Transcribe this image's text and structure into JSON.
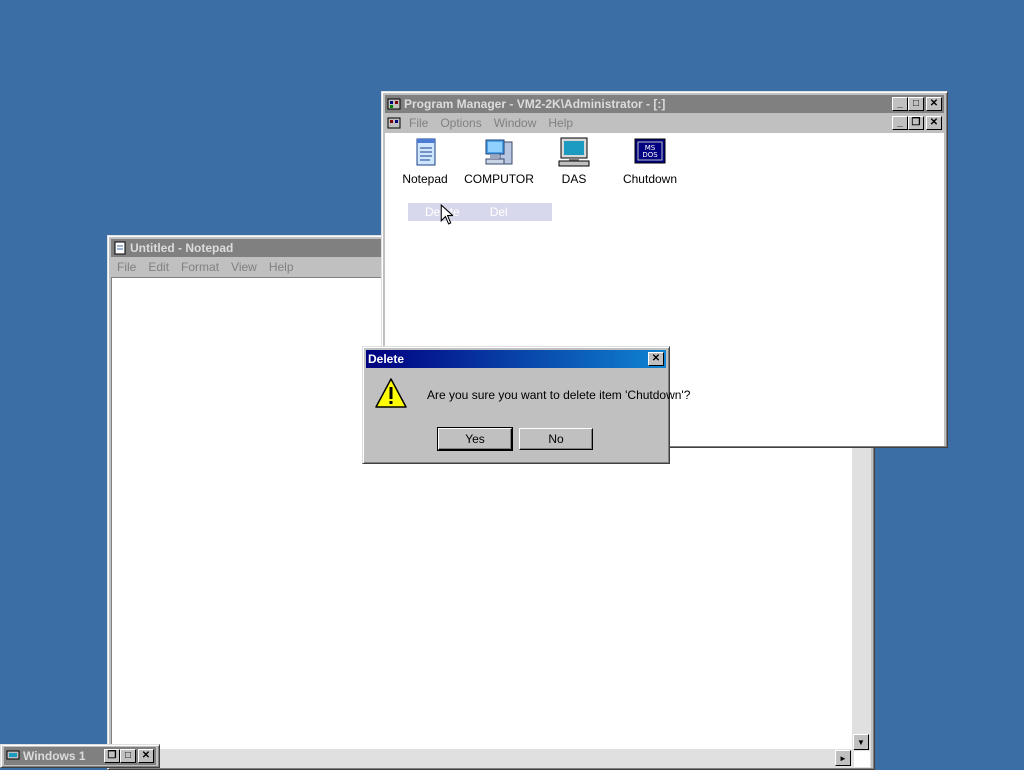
{
  "desktop": {
    "background": "#3a6ea5"
  },
  "notepad": {
    "title": "Untitled - Notepad",
    "menu": [
      "File",
      "Edit",
      "Format",
      "View",
      "Help"
    ],
    "scroll_down_glyph": "▼",
    "scroll_right_glyph": "►"
  },
  "program_manager": {
    "title": "Program Manager - VM2-2K\\Administrator - [:]",
    "menu": [
      "File",
      "Options",
      "Window",
      "Help"
    ],
    "icons": [
      {
        "label": "Notepad",
        "icon": "notepad-icon"
      },
      {
        "label": "COMPUTOR",
        "icon": "computer-icon"
      },
      {
        "label": "DAS",
        "icon": "monitor-icon"
      },
      {
        "label": "Chutdown",
        "icon": "msdos-icon",
        "badge": "MS\nDOS"
      }
    ],
    "selected_items": [
      "Delete",
      "Del"
    ]
  },
  "dialog": {
    "title": "Delete",
    "message": "Are you sure you want to delete item 'Chutdown'?",
    "yes_label": "Yes",
    "no_label": "No",
    "icon": "warning-icon"
  },
  "minimized": {
    "title": "Windows 1"
  },
  "controls": {
    "minimize": "_",
    "maximize": "□",
    "restore": "❐",
    "close": "✕"
  }
}
